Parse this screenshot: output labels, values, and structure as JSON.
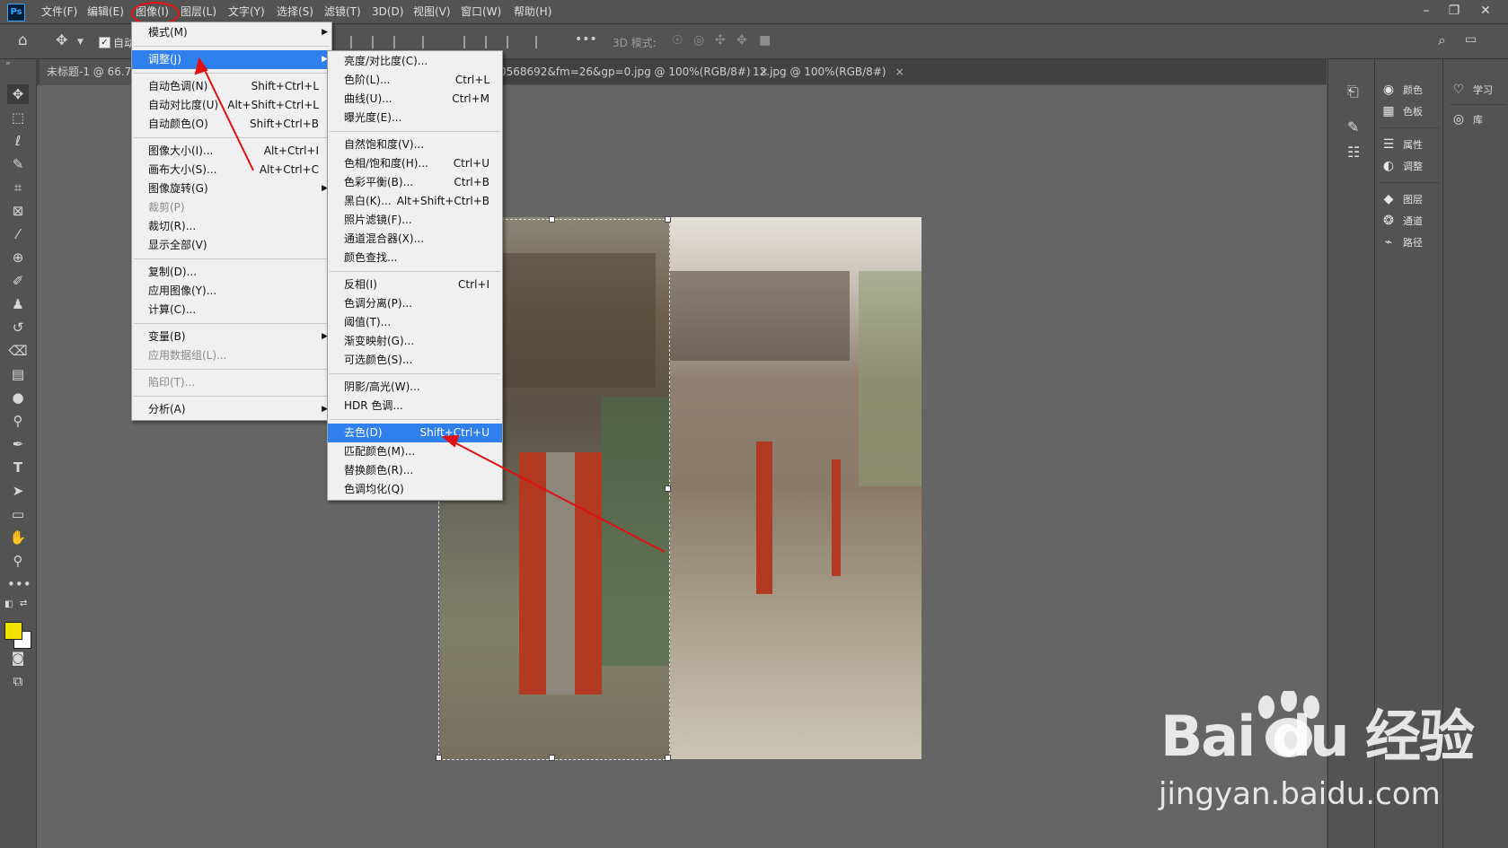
{
  "app": {
    "logo_text": "Ps",
    "brand_color": "#31a8ff"
  },
  "menubar": {
    "items": [
      "文件(F)",
      "编辑(E)",
      "图像(I)",
      "图层(L)",
      "文字(Y)",
      "选择(S)",
      "滤镜(T)",
      "3D(D)",
      "视图(V)",
      "窗口(W)",
      "帮助(H)"
    ],
    "active": "图像(I)",
    "window_controls": [
      "–",
      "❐",
      "✕"
    ]
  },
  "options_bar": {
    "auto_select_label": "自动",
    "mode_3d_label": "3D 模式:"
  },
  "tabs": [
    {
      "label": "未标题-1 @ 66.7",
      "close": ""
    },
    {
      "label": "0568692&fm=26&gp=0.jpg @ 100%(RGB/8#)",
      "close": "×"
    },
    {
      "label": "12.jpg @ 100%(RGB/8#)",
      "close": "×"
    }
  ],
  "image_menu": {
    "items": [
      {
        "label": "模式(M)",
        "shortcut": "",
        "submenu": true
      },
      {
        "separator": true
      },
      {
        "label": "调整(J)",
        "shortcut": "",
        "submenu": true,
        "highlighted": true
      },
      {
        "separator": true
      },
      {
        "label": "自动色调(N)",
        "shortcut": "Shift+Ctrl+L"
      },
      {
        "label": "自动对比度(U)",
        "shortcut": "Alt+Shift+Ctrl+L"
      },
      {
        "label": "自动颜色(O)",
        "shortcut": "Shift+Ctrl+B"
      },
      {
        "separator": true
      },
      {
        "label": "图像大小(I)...",
        "shortcut": "Alt+Ctrl+I"
      },
      {
        "label": "画布大小(S)...",
        "shortcut": "Alt+Ctrl+C"
      },
      {
        "label": "图像旋转(G)",
        "shortcut": "",
        "submenu": true
      },
      {
        "label": "裁剪(P)",
        "shortcut": "",
        "disabled": true
      },
      {
        "label": "裁切(R)...",
        "shortcut": ""
      },
      {
        "label": "显示全部(V)",
        "shortcut": ""
      },
      {
        "separator": true
      },
      {
        "label": "复制(D)...",
        "shortcut": ""
      },
      {
        "label": "应用图像(Y)...",
        "shortcut": ""
      },
      {
        "label": "计算(C)...",
        "shortcut": ""
      },
      {
        "separator": true
      },
      {
        "label": "变量(B)",
        "shortcut": "",
        "submenu": true
      },
      {
        "label": "应用数据组(L)...",
        "shortcut": "",
        "disabled": true
      },
      {
        "separator": true
      },
      {
        "label": "陷印(T)...",
        "shortcut": "",
        "disabled": true
      },
      {
        "separator": true
      },
      {
        "label": "分析(A)",
        "shortcut": "",
        "submenu": true
      }
    ]
  },
  "adjust_menu": {
    "items": [
      {
        "label": "亮度/对比度(C)...",
        "shortcut": ""
      },
      {
        "label": "色阶(L)...",
        "shortcut": "Ctrl+L"
      },
      {
        "label": "曲线(U)...",
        "shortcut": "Ctrl+M"
      },
      {
        "label": "曝光度(E)...",
        "shortcut": ""
      },
      {
        "separator": true
      },
      {
        "label": "自然饱和度(V)...",
        "shortcut": ""
      },
      {
        "label": "色相/饱和度(H)...",
        "shortcut": "Ctrl+U"
      },
      {
        "label": "色彩平衡(B)...",
        "shortcut": "Ctrl+B"
      },
      {
        "label": "黑白(K)...",
        "shortcut": "Alt+Shift+Ctrl+B"
      },
      {
        "label": "照片滤镜(F)...",
        "shortcut": ""
      },
      {
        "label": "通道混合器(X)...",
        "shortcut": ""
      },
      {
        "label": "颜色查找...",
        "shortcut": ""
      },
      {
        "separator": true
      },
      {
        "label": "反相(I)",
        "shortcut": "Ctrl+I"
      },
      {
        "label": "色调分离(P)...",
        "shortcut": ""
      },
      {
        "label": "阈值(T)...",
        "shortcut": ""
      },
      {
        "label": "渐变映射(G)...",
        "shortcut": ""
      },
      {
        "label": "可选颜色(S)...",
        "shortcut": ""
      },
      {
        "separator": true
      },
      {
        "label": "阴影/高光(W)...",
        "shortcut": ""
      },
      {
        "label": "HDR 色调...",
        "shortcut": ""
      },
      {
        "separator": true
      },
      {
        "label": "去色(D)",
        "shortcut": "Shift+Ctrl+U",
        "highlighted": true
      },
      {
        "label": "匹配颜色(M)...",
        "shortcut": ""
      },
      {
        "label": "替换颜色(R)...",
        "shortcut": ""
      },
      {
        "label": "色调均化(Q)",
        "shortcut": ""
      }
    ]
  },
  "panels": {
    "col1": [
      {
        "icon": "palette-icon",
        "glyph": "◉",
        "label": "颜色"
      },
      {
        "icon": "swatches-icon",
        "glyph": "▦",
        "label": "色板"
      },
      {
        "icon": "properties-icon",
        "glyph": "☰",
        "label": "属性"
      },
      {
        "icon": "adjustments-icon",
        "glyph": "◐",
        "label": "调整"
      },
      {
        "icon": "layers-icon",
        "glyph": "◆",
        "label": "图层"
      },
      {
        "icon": "channels-icon",
        "glyph": "❂",
        "label": "通道"
      },
      {
        "icon": "paths-icon",
        "glyph": "⌁",
        "label": "路径"
      }
    ],
    "col2": [
      {
        "icon": "learn-icon",
        "glyph": "♡",
        "label": "学习"
      },
      {
        "icon": "libraries-icon",
        "glyph": "◎",
        "label": "库"
      }
    ]
  },
  "colors": {
    "foreground": "#f0e000",
    "background": "#ffffff",
    "highlight": "#2f80ed",
    "annotation": "#e11111"
  },
  "watermark": {
    "logo": "Bai  du 经验",
    "url": "jingyan.baidu.com"
  }
}
